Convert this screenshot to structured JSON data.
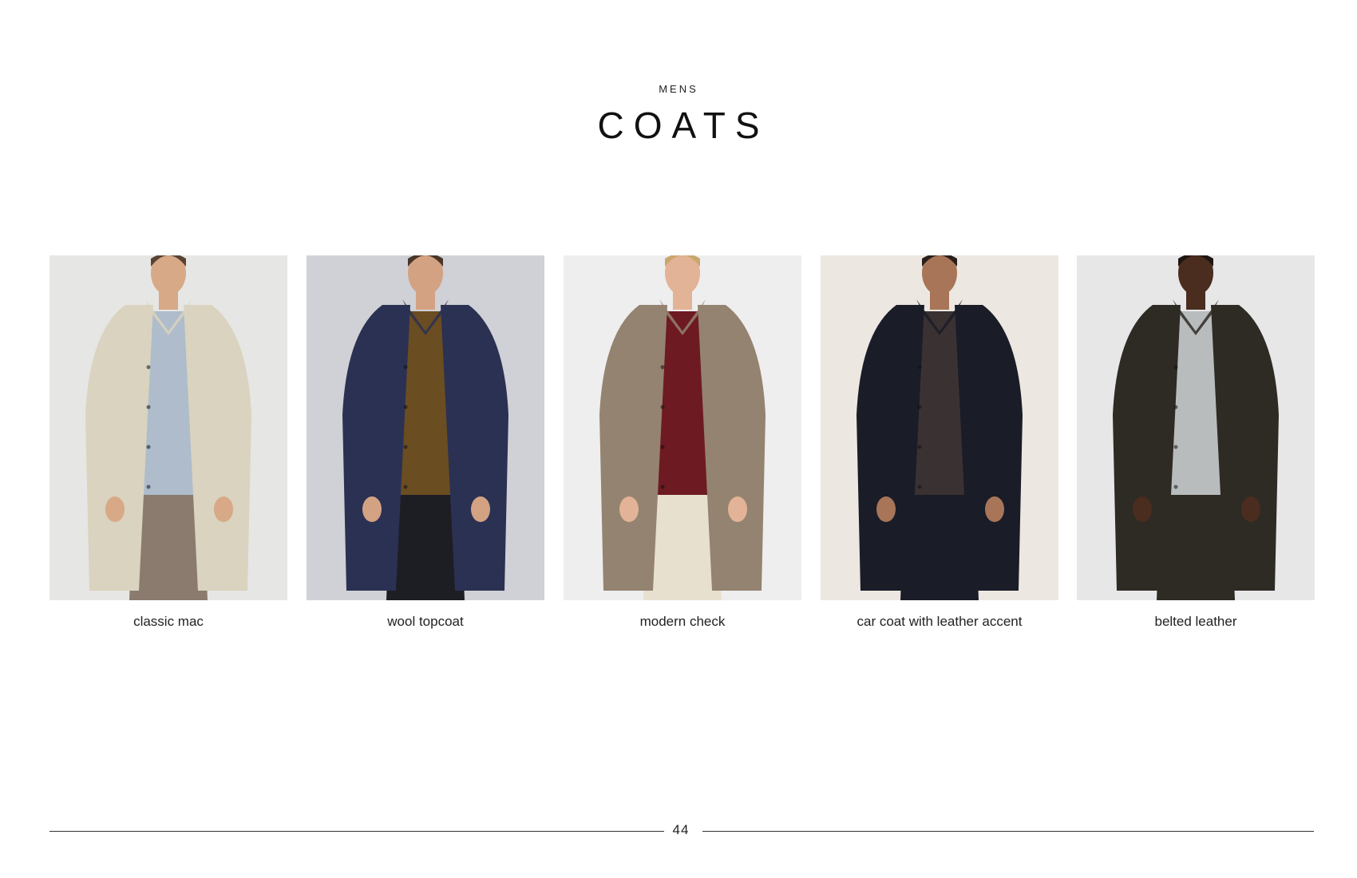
{
  "header": {
    "eyebrow": "MENS",
    "title": "COATS"
  },
  "products": [
    {
      "caption": "classic mac",
      "image": "man-in-beige-mac-coat",
      "colors": {
        "bg": "#e6e6e4",
        "coat": "#d9d3bf",
        "inner": "#aebccb",
        "pants": "#8b7b6e",
        "skin": "#d7a987",
        "hair": "#5a4232"
      }
    },
    {
      "caption": "wool topcoat",
      "image": "man-in-navy-wool-topcoat",
      "colors": {
        "bg": "#cfd1d6",
        "coat": "#2b3152",
        "inner": "#6b4d22",
        "pants": "#1d1d24",
        "skin": "#d3a283",
        "hair": "#4a3628"
      }
    },
    {
      "caption": "modern check",
      "image": "man-in-check-coat",
      "colors": {
        "bg": "#eeeeef",
        "coat": "#948370",
        "inner": "#6e1a22",
        "pants": "#e8e0cf",
        "skin": "#e2b396",
        "hair": "#c9a76c"
      }
    },
    {
      "caption": "car coat with leather accent",
      "image": "man-in-black-car-coat",
      "colors": {
        "bg": "#ece7e1",
        "coat": "#1a1c28",
        "inner": "#3a3232",
        "pants": "#1a1c28",
        "skin": "#a87558",
        "hair": "#2a1f1a"
      }
    },
    {
      "caption": "belted leather",
      "image": "man-in-belted-leather-jacket",
      "colors": {
        "bg": "#e7e7e8",
        "coat": "#2e2a24",
        "inner": "#b9bcbc",
        "pants": "#2e2a24",
        "skin": "#4a2d1f",
        "hair": "#1f1612"
      }
    }
  ],
  "footer": {
    "page_number": "44"
  }
}
